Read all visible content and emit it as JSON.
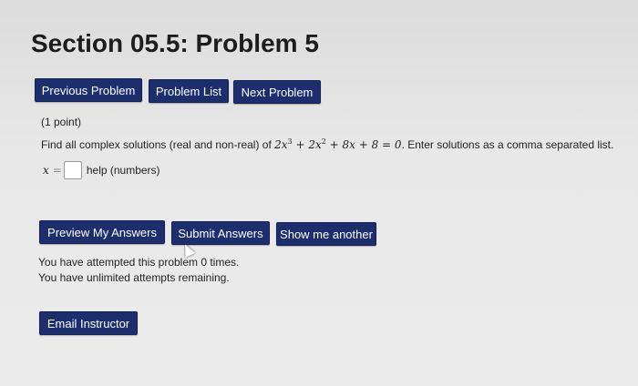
{
  "page": {
    "title": "Section 05.5: Problem 5"
  },
  "nav": {
    "previous_label": "Previous Problem",
    "list_label": "Problem List",
    "next_label": "Next Problem"
  },
  "problem": {
    "points": "(1 point)",
    "text_before": "Find all complex solutions (real and non-real) of ",
    "equation": {
      "t1": "2x",
      "e1": "3",
      "op1": " + ",
      "t2": "2x",
      "e2": "2",
      "op2": " + ",
      "t3": "8x",
      "op3": " + ",
      "t4": "8",
      "eq": " = ",
      "rhs": "0"
    },
    "text_after": ". Enter solutions as a comma separated list.",
    "answer_var": "x",
    "answer_eq": "=",
    "answer_value": "",
    "help_text": "help (numbers)"
  },
  "actions": {
    "preview_label": "Preview My Answers",
    "submit_label": "Submit Answers",
    "another_label": "Show me another"
  },
  "status": {
    "attempted": "You have attempted this problem 0 times.",
    "remaining": "You have unlimited attempts remaining."
  },
  "footer": {
    "email_label": "Email Instructor"
  }
}
